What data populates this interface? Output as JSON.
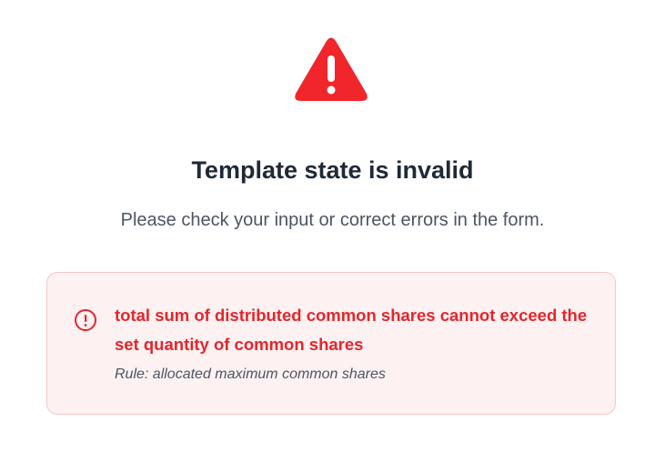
{
  "status": {
    "title": "Template state is invalid",
    "subtitle": "Please check your input or correct errors in the form.",
    "icon": "warning-triangle-icon",
    "icon_color": "#f0262b"
  },
  "errors": [
    {
      "icon": "exclamation-circle-icon",
      "message": "total sum of distributed common shares cannot exceed the set quantity of common shares",
      "rule": "Rule: allocated maximum common shares",
      "color": "#e3262d",
      "background": "#fef1f1"
    }
  ]
}
